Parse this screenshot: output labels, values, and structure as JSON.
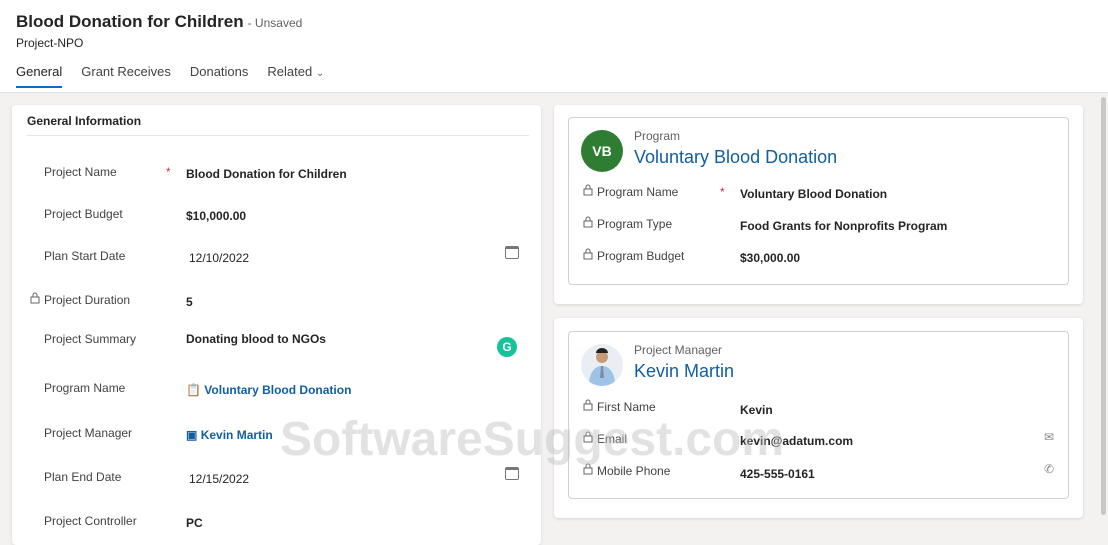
{
  "header": {
    "title": "Blood Donation for Children",
    "status": "- Unsaved",
    "entity": "Project-NPO"
  },
  "tabs": [
    {
      "label": "General"
    },
    {
      "label": "Grant Receives"
    },
    {
      "label": "Donations"
    },
    {
      "label": "Related"
    }
  ],
  "general": {
    "section_title": "General Information",
    "fields": [
      {
        "label": "Project Name",
        "value": "Blood Donation for Children",
        "required": "*"
      },
      {
        "label": "Project Budget",
        "value": "$10,000.00"
      },
      {
        "label": "Plan Start Date",
        "value": "12/10/2022"
      },
      {
        "label": "Project Duration",
        "value": "5"
      },
      {
        "label": "Project Summary",
        "value": "Donating blood to NGOs"
      },
      {
        "label": "Program Name",
        "value": "Voluntary Blood Donation"
      },
      {
        "label": "Project Manager",
        "value": "Kevin Martin"
      },
      {
        "label": "Plan End Date",
        "value": "12/15/2022"
      },
      {
        "label": "Project Controller",
        "value": "PC"
      }
    ]
  },
  "program_card": {
    "type": "Program",
    "initials": "VB",
    "name": "Voluntary Blood Donation",
    "fields": [
      {
        "label": "Program Name",
        "value": "Voluntary Blood Donation",
        "required": "*"
      },
      {
        "label": "Program Type",
        "value": "Food Grants for Nonprofits Program"
      },
      {
        "label": "Program Budget",
        "value": "$30,000.00"
      }
    ]
  },
  "manager_card": {
    "type": "Project Manager",
    "name": "Kevin Martin",
    "fields": [
      {
        "label": "First Name",
        "value": "Kevin"
      },
      {
        "label": "Email",
        "value": "kevin@adatum.com"
      },
      {
        "label": "Mobile Phone",
        "value": "425-555-0161"
      }
    ]
  },
  "grammarly_letter": "G",
  "watermark": "SoftwareSuggest.com",
  "colors": {
    "accent": "#0f6cbd",
    "link": "#115ea3",
    "avatar": "#2e7d32"
  }
}
